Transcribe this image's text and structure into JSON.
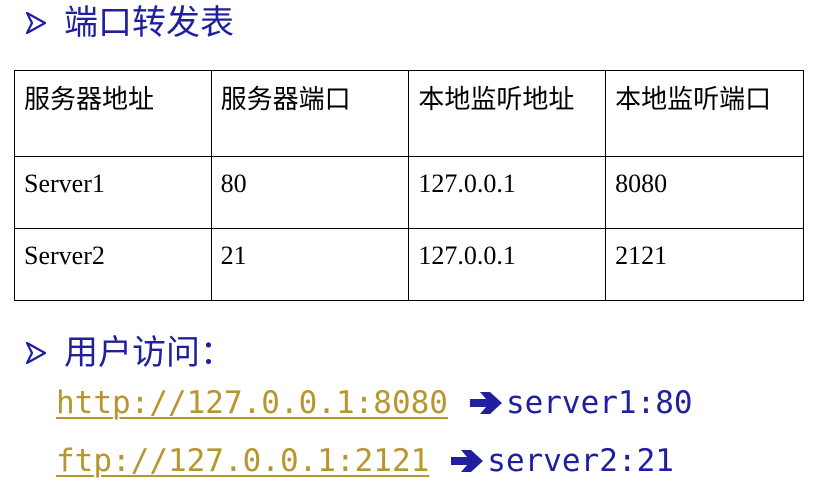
{
  "section1": {
    "title": "端口转发表"
  },
  "table": {
    "headers": [
      "服务器地址",
      "服务器端口",
      "本地监听地址",
      "本地监听端口"
    ],
    "rows": [
      [
        "Server1",
        "80",
        "127.0.0.1",
        "8080"
      ],
      [
        "Server2",
        "21",
        "127.0.0.1",
        "2121"
      ]
    ]
  },
  "section2": {
    "title": "用户访问：",
    "links": [
      {
        "url": "http://127.0.0.1:8080",
        "target": "server1:80"
      },
      {
        "url": "ftp://127.0.0.1:2121",
        "target": "server2:21"
      }
    ]
  },
  "colors": {
    "heading": "#1f1fa0",
    "link": "#b8962e",
    "table_border": "#000000"
  },
  "icons": {
    "bullet": "arrowhead-bullet-icon",
    "arrow": "right-arrow-icon"
  }
}
